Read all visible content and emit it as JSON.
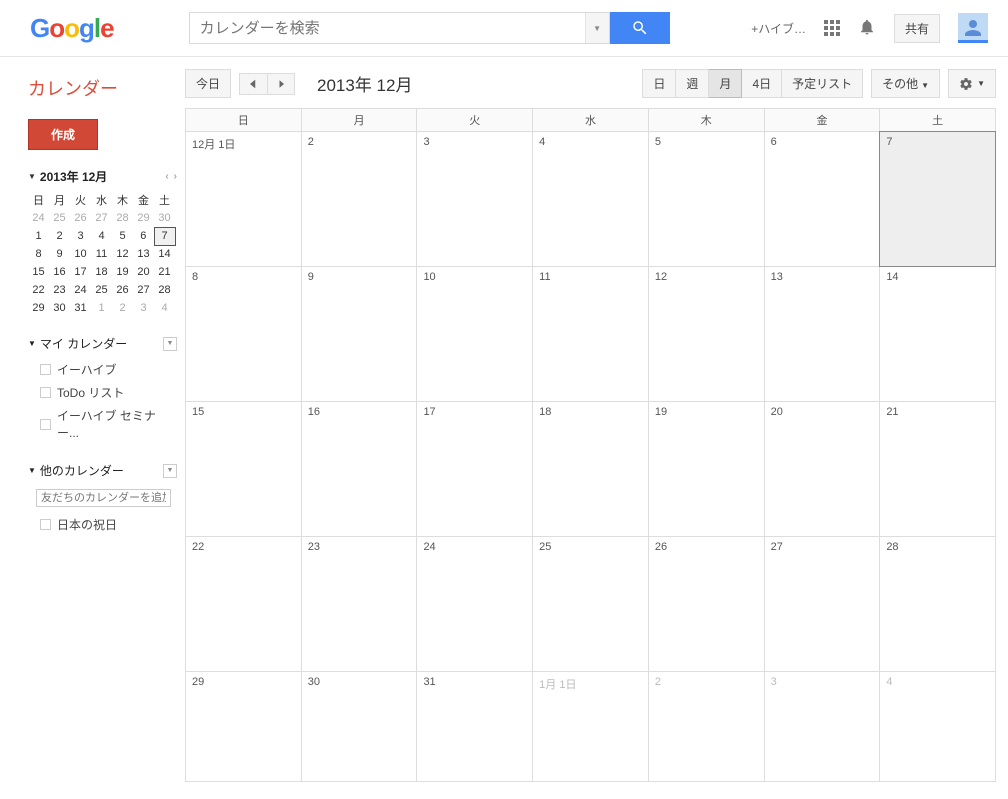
{
  "header": {
    "logo_letters": [
      "G",
      "o",
      "o",
      "g",
      "l",
      "e"
    ],
    "search_placeholder": "カレンダーを検索",
    "plus_text": "+ハイブ…",
    "share_label": "共有"
  },
  "sidebar": {
    "app_title": "カレンダー",
    "create_label": "作成",
    "mini_month": "2013年 12月",
    "day_headers": [
      "日",
      "月",
      "火",
      "水",
      "木",
      "金",
      "土"
    ],
    "mini_weeks": [
      [
        {
          "d": "24",
          "dim": true
        },
        {
          "d": "25",
          "dim": true
        },
        {
          "d": "26",
          "dim": true
        },
        {
          "d": "27",
          "dim": true
        },
        {
          "d": "28",
          "dim": true
        },
        {
          "d": "29",
          "dim": true
        },
        {
          "d": "30",
          "dim": true
        }
      ],
      [
        {
          "d": "1"
        },
        {
          "d": "2"
        },
        {
          "d": "3"
        },
        {
          "d": "4"
        },
        {
          "d": "5"
        },
        {
          "d": "6"
        },
        {
          "d": "7",
          "today": true
        }
      ],
      [
        {
          "d": "8"
        },
        {
          "d": "9"
        },
        {
          "d": "10"
        },
        {
          "d": "11"
        },
        {
          "d": "12"
        },
        {
          "d": "13"
        },
        {
          "d": "14"
        }
      ],
      [
        {
          "d": "15"
        },
        {
          "d": "16"
        },
        {
          "d": "17"
        },
        {
          "d": "18"
        },
        {
          "d": "19"
        },
        {
          "d": "20"
        },
        {
          "d": "21"
        }
      ],
      [
        {
          "d": "22"
        },
        {
          "d": "23"
        },
        {
          "d": "24"
        },
        {
          "d": "25"
        },
        {
          "d": "26"
        },
        {
          "d": "27"
        },
        {
          "d": "28"
        }
      ],
      [
        {
          "d": "29"
        },
        {
          "d": "30"
        },
        {
          "d": "31"
        },
        {
          "d": "1",
          "dim": true
        },
        {
          "d": "2",
          "dim": true
        },
        {
          "d": "3",
          "dim": true
        },
        {
          "d": "4",
          "dim": true
        }
      ]
    ],
    "my_calendars_label": "マイ カレンダー",
    "my_calendars": [
      "イーハイブ",
      "ToDo リスト",
      "イーハイブ セミナー..."
    ],
    "other_calendars_label": "他のカレンダー",
    "add_friend_placeholder": "友だちのカレンダーを追加",
    "other_calendars": [
      "日本の祝日"
    ]
  },
  "toolbar": {
    "today_label": "今日",
    "current_month": "2013年 12月",
    "views": {
      "day": "日",
      "week": "週",
      "month": "月",
      "four_day": "4日",
      "agenda": "予定リスト"
    },
    "more_label": "その他",
    "active_view": "month"
  },
  "grid": {
    "day_headers": [
      "日",
      "月",
      "火",
      "水",
      "木",
      "金",
      "土"
    ],
    "weeks": [
      [
        {
          "d": "12月 1日"
        },
        {
          "d": "2"
        },
        {
          "d": "3"
        },
        {
          "d": "4"
        },
        {
          "d": "5"
        },
        {
          "d": "6"
        },
        {
          "d": "7",
          "today": true
        }
      ],
      [
        {
          "d": "8"
        },
        {
          "d": "9"
        },
        {
          "d": "10"
        },
        {
          "d": "11"
        },
        {
          "d": "12"
        },
        {
          "d": "13"
        },
        {
          "d": "14"
        }
      ],
      [
        {
          "d": "15"
        },
        {
          "d": "16"
        },
        {
          "d": "17"
        },
        {
          "d": "18"
        },
        {
          "d": "19"
        },
        {
          "d": "20"
        },
        {
          "d": "21"
        }
      ],
      [
        {
          "d": "22"
        },
        {
          "d": "23"
        },
        {
          "d": "24"
        },
        {
          "d": "25"
        },
        {
          "d": "26"
        },
        {
          "d": "27"
        },
        {
          "d": "28"
        }
      ],
      [
        {
          "d": "29"
        },
        {
          "d": "30"
        },
        {
          "d": "31"
        },
        {
          "d": "1月 1日",
          "other": true
        },
        {
          "d": "2",
          "other": true
        },
        {
          "d": "3",
          "other": true
        },
        {
          "d": "4",
          "other": true
        }
      ]
    ]
  }
}
